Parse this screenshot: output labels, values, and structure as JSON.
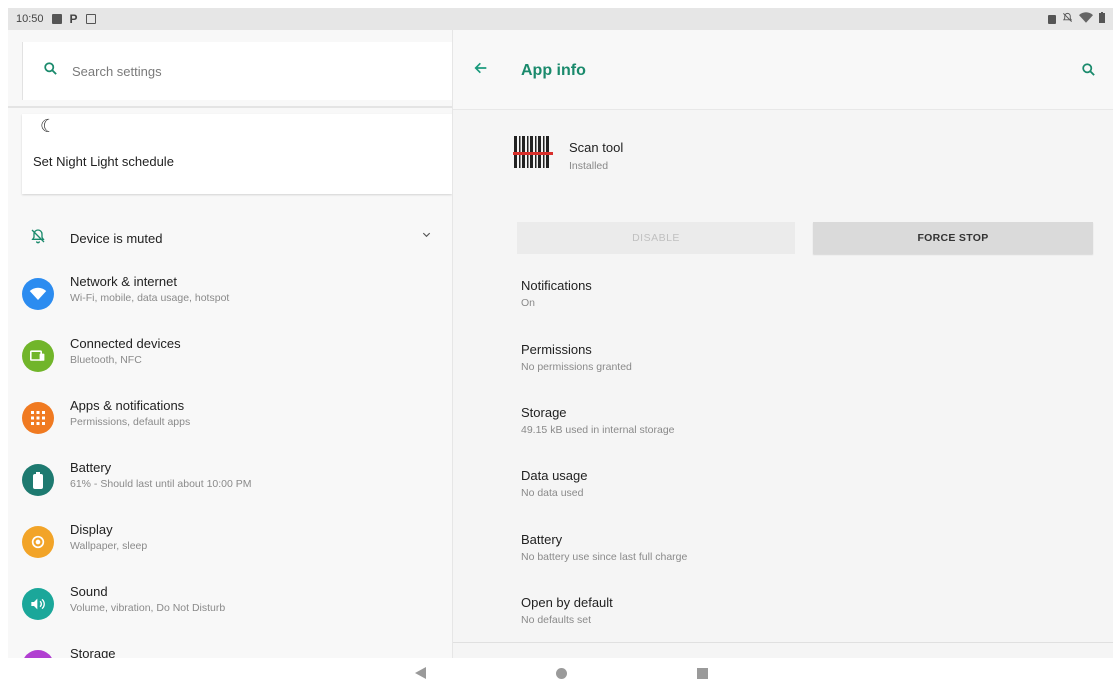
{
  "status_bar": {
    "time": "10:50",
    "left_icons": [
      "image-icon",
      "p-icon",
      "calendar-icon"
    ],
    "right_icons": [
      "sd-icon",
      "mute-icon",
      "wifi-icon",
      "battery-icon"
    ]
  },
  "left_pane": {
    "search_placeholder": "Search settings",
    "night_light": {
      "icon": "moon-icon",
      "label": "Set Night Light schedule"
    },
    "muted": {
      "icon": "bell-off-icon",
      "label": "Device is muted"
    },
    "items": [
      {
        "title": "Network & internet",
        "subtitle": "Wi-Fi, mobile, data usage, hotspot",
        "icon": "wifi-icon",
        "color": "#2c8cf0"
      },
      {
        "title": "Connected devices",
        "subtitle": "Bluetooth, NFC",
        "icon": "devices-icon",
        "color": "#71b52a"
      },
      {
        "title": "Apps & notifications",
        "subtitle": "Permissions, default apps",
        "icon": "apps-icon",
        "color": "#f07a21"
      },
      {
        "title": "Battery",
        "subtitle": "61% - Should last until about 10:00 PM",
        "icon": "battery-icon",
        "color": "#1e7a70"
      },
      {
        "title": "Display",
        "subtitle": "Wallpaper, sleep",
        "icon": "brightness-icon",
        "color": "#f2a428"
      },
      {
        "title": "Sound",
        "subtitle": "Volume, vibration, Do Not Disturb",
        "icon": "volume-icon",
        "color": "#1ba79a"
      },
      {
        "title": "Storage",
        "subtitle": "",
        "icon": "storage-icon",
        "color": "#b13fd1"
      }
    ]
  },
  "right_pane": {
    "title": "App info",
    "app": {
      "name": "Scan tool",
      "status": "Installed"
    },
    "buttons": {
      "disable": "DISABLE",
      "force_stop": "FORCE STOP"
    },
    "items": [
      {
        "title": "Notifications",
        "subtitle": "On"
      },
      {
        "title": "Permissions",
        "subtitle": "No permissions granted"
      },
      {
        "title": "Storage",
        "subtitle": "49.15 kB used in internal storage"
      },
      {
        "title": "Data usage",
        "subtitle": "No data used"
      },
      {
        "title": "Battery",
        "subtitle": "No battery use since last full charge"
      },
      {
        "title": "Open by default",
        "subtitle": "No defaults set"
      }
    ]
  },
  "colors": {
    "accent": "#1a8a6c",
    "status_bar_bg": "#e6e6e6"
  }
}
